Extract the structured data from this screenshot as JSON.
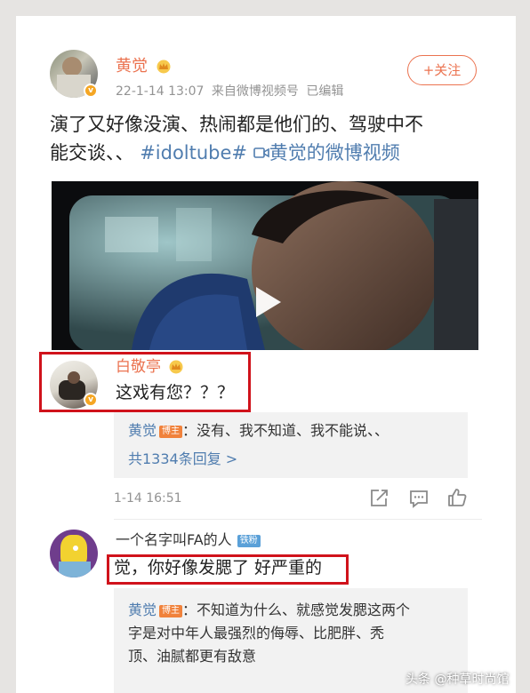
{
  "post": {
    "author": "黄觉",
    "meta": {
      "date": "22-1-14 13:07",
      "source": "来自微博视频号",
      "edited": "已编辑"
    },
    "follow_label": "+关注",
    "text_line1": "演了又好像没演、热闹都是他们的、驾驶中不",
    "text_line2_plain": "能交谈、、",
    "hashtag": "#idoltube#",
    "video_link": "黄觉的微博视频"
  },
  "comments": [
    {
      "user": "白敬亭",
      "text": "这戏有您？？？",
      "reply": {
        "user": "黄觉",
        "tag": "博主",
        "text": "：没有、我不知道、我不能说、、",
        "more": "共1334条回复 >"
      },
      "time": "1-14 16:51"
    },
    {
      "user": "一个名字叫FA的人",
      "fan_tag": "铁粉",
      "text": "觉，你好像发腮了 好严重的",
      "reply": {
        "user": "黄觉",
        "tag": "博主",
        "text_line1": "：不知道为什么、就感觉发腮这两个",
        "text_line2": "字是对中年人最强烈的侮辱、比肥胖、秃",
        "text_line3": "顶、油腻都更有敌意"
      }
    }
  ],
  "watermark": "头条 @种草时尚馆",
  "colors": {
    "accent_orange": "#eb7350",
    "link_blue": "#507daf",
    "highlight_red": "#d0121b"
  }
}
